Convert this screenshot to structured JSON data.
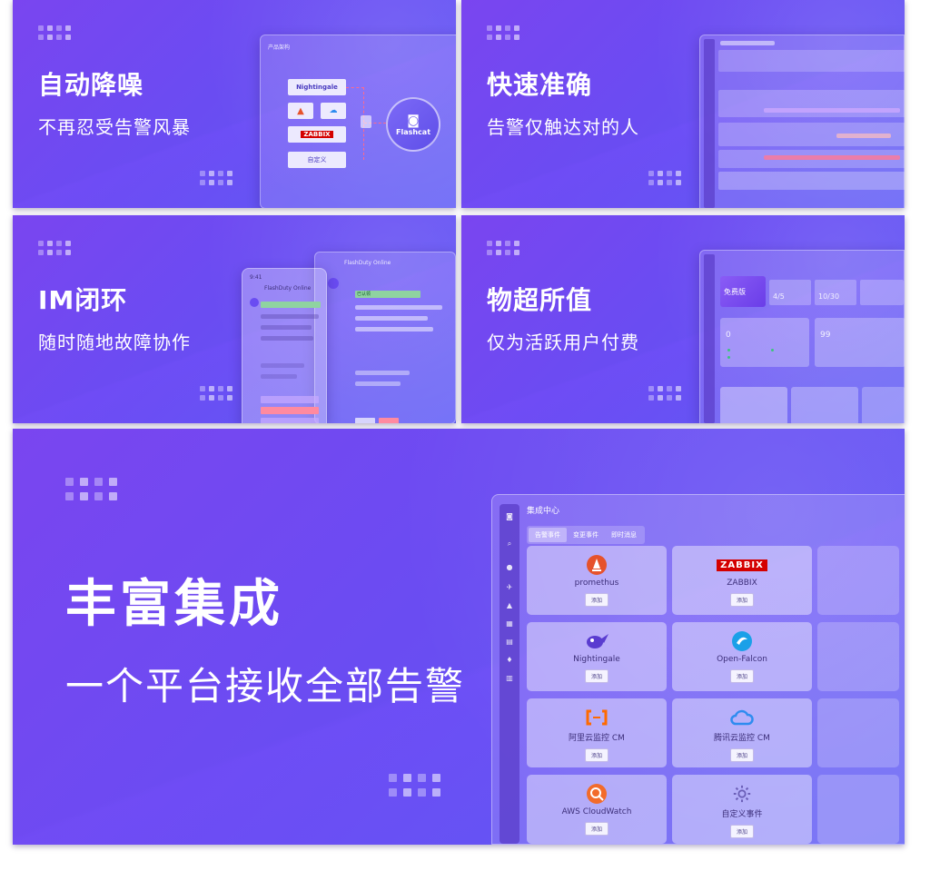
{
  "panels": {
    "noise": {
      "title": "自动降噪",
      "subtitle": "不再忍受告警风暴",
      "window_title": "产品架构",
      "sources": [
        "Nightingale",
        "ZABBIX",
        "自定义"
      ],
      "hub_label": "Flashcat"
    },
    "accurate": {
      "title": "快速准确",
      "subtitle": "告警仅触达对的人"
    },
    "im": {
      "title": "IM闭环",
      "subtitle": "随时随地故障协作",
      "app_name": "FlashDuty Online",
      "status_badge": "已认领",
      "time": "9:41"
    },
    "value": {
      "title": "物超所值",
      "subtitle": "仅为活跃用户付费",
      "plan_label": "免费版",
      "stat_values": [
        "4/5",
        "10/30",
        "0",
        "99"
      ]
    },
    "integration": {
      "title": "丰富集成",
      "subtitle": "一个平台接收全部告警"
    }
  },
  "app": {
    "title": "集成中心",
    "tabs": [
      {
        "label": "告警事件",
        "active": true
      },
      {
        "label": "变更事件",
        "active": false
      },
      {
        "label": "即时消息",
        "active": false
      }
    ],
    "add_label": "添加",
    "cards": [
      {
        "name": "promethus",
        "icon": "prometheus-icon",
        "color": "#e6522c"
      },
      {
        "name": "ZABBIX",
        "icon": "zabbix-logo",
        "color": "#d40000"
      },
      {
        "name": "Nightingale",
        "icon": "nightingale-icon",
        "color": "#5a3cd0"
      },
      {
        "name": "Open-Falcon",
        "icon": "open-falcon-icon",
        "color": "#1aa0e8"
      },
      {
        "name": "阿里云监控 CM",
        "icon": "aliyun-icon",
        "color": "#ff6a00"
      },
      {
        "name": "腾讯云监控 CM",
        "icon": "tencent-cloud-icon",
        "color": "#2e8cf0"
      },
      {
        "name": "AWS CloudWatch",
        "icon": "aws-cloudwatch-icon",
        "color": "#f26b2b"
      },
      {
        "name": "自定义事件",
        "icon": "gear-icon",
        "color": "#6b5fb8"
      }
    ]
  },
  "colors": {
    "accent": "#6a4cf2",
    "alert": "#ff6a8a",
    "success": "#3cc47c"
  }
}
